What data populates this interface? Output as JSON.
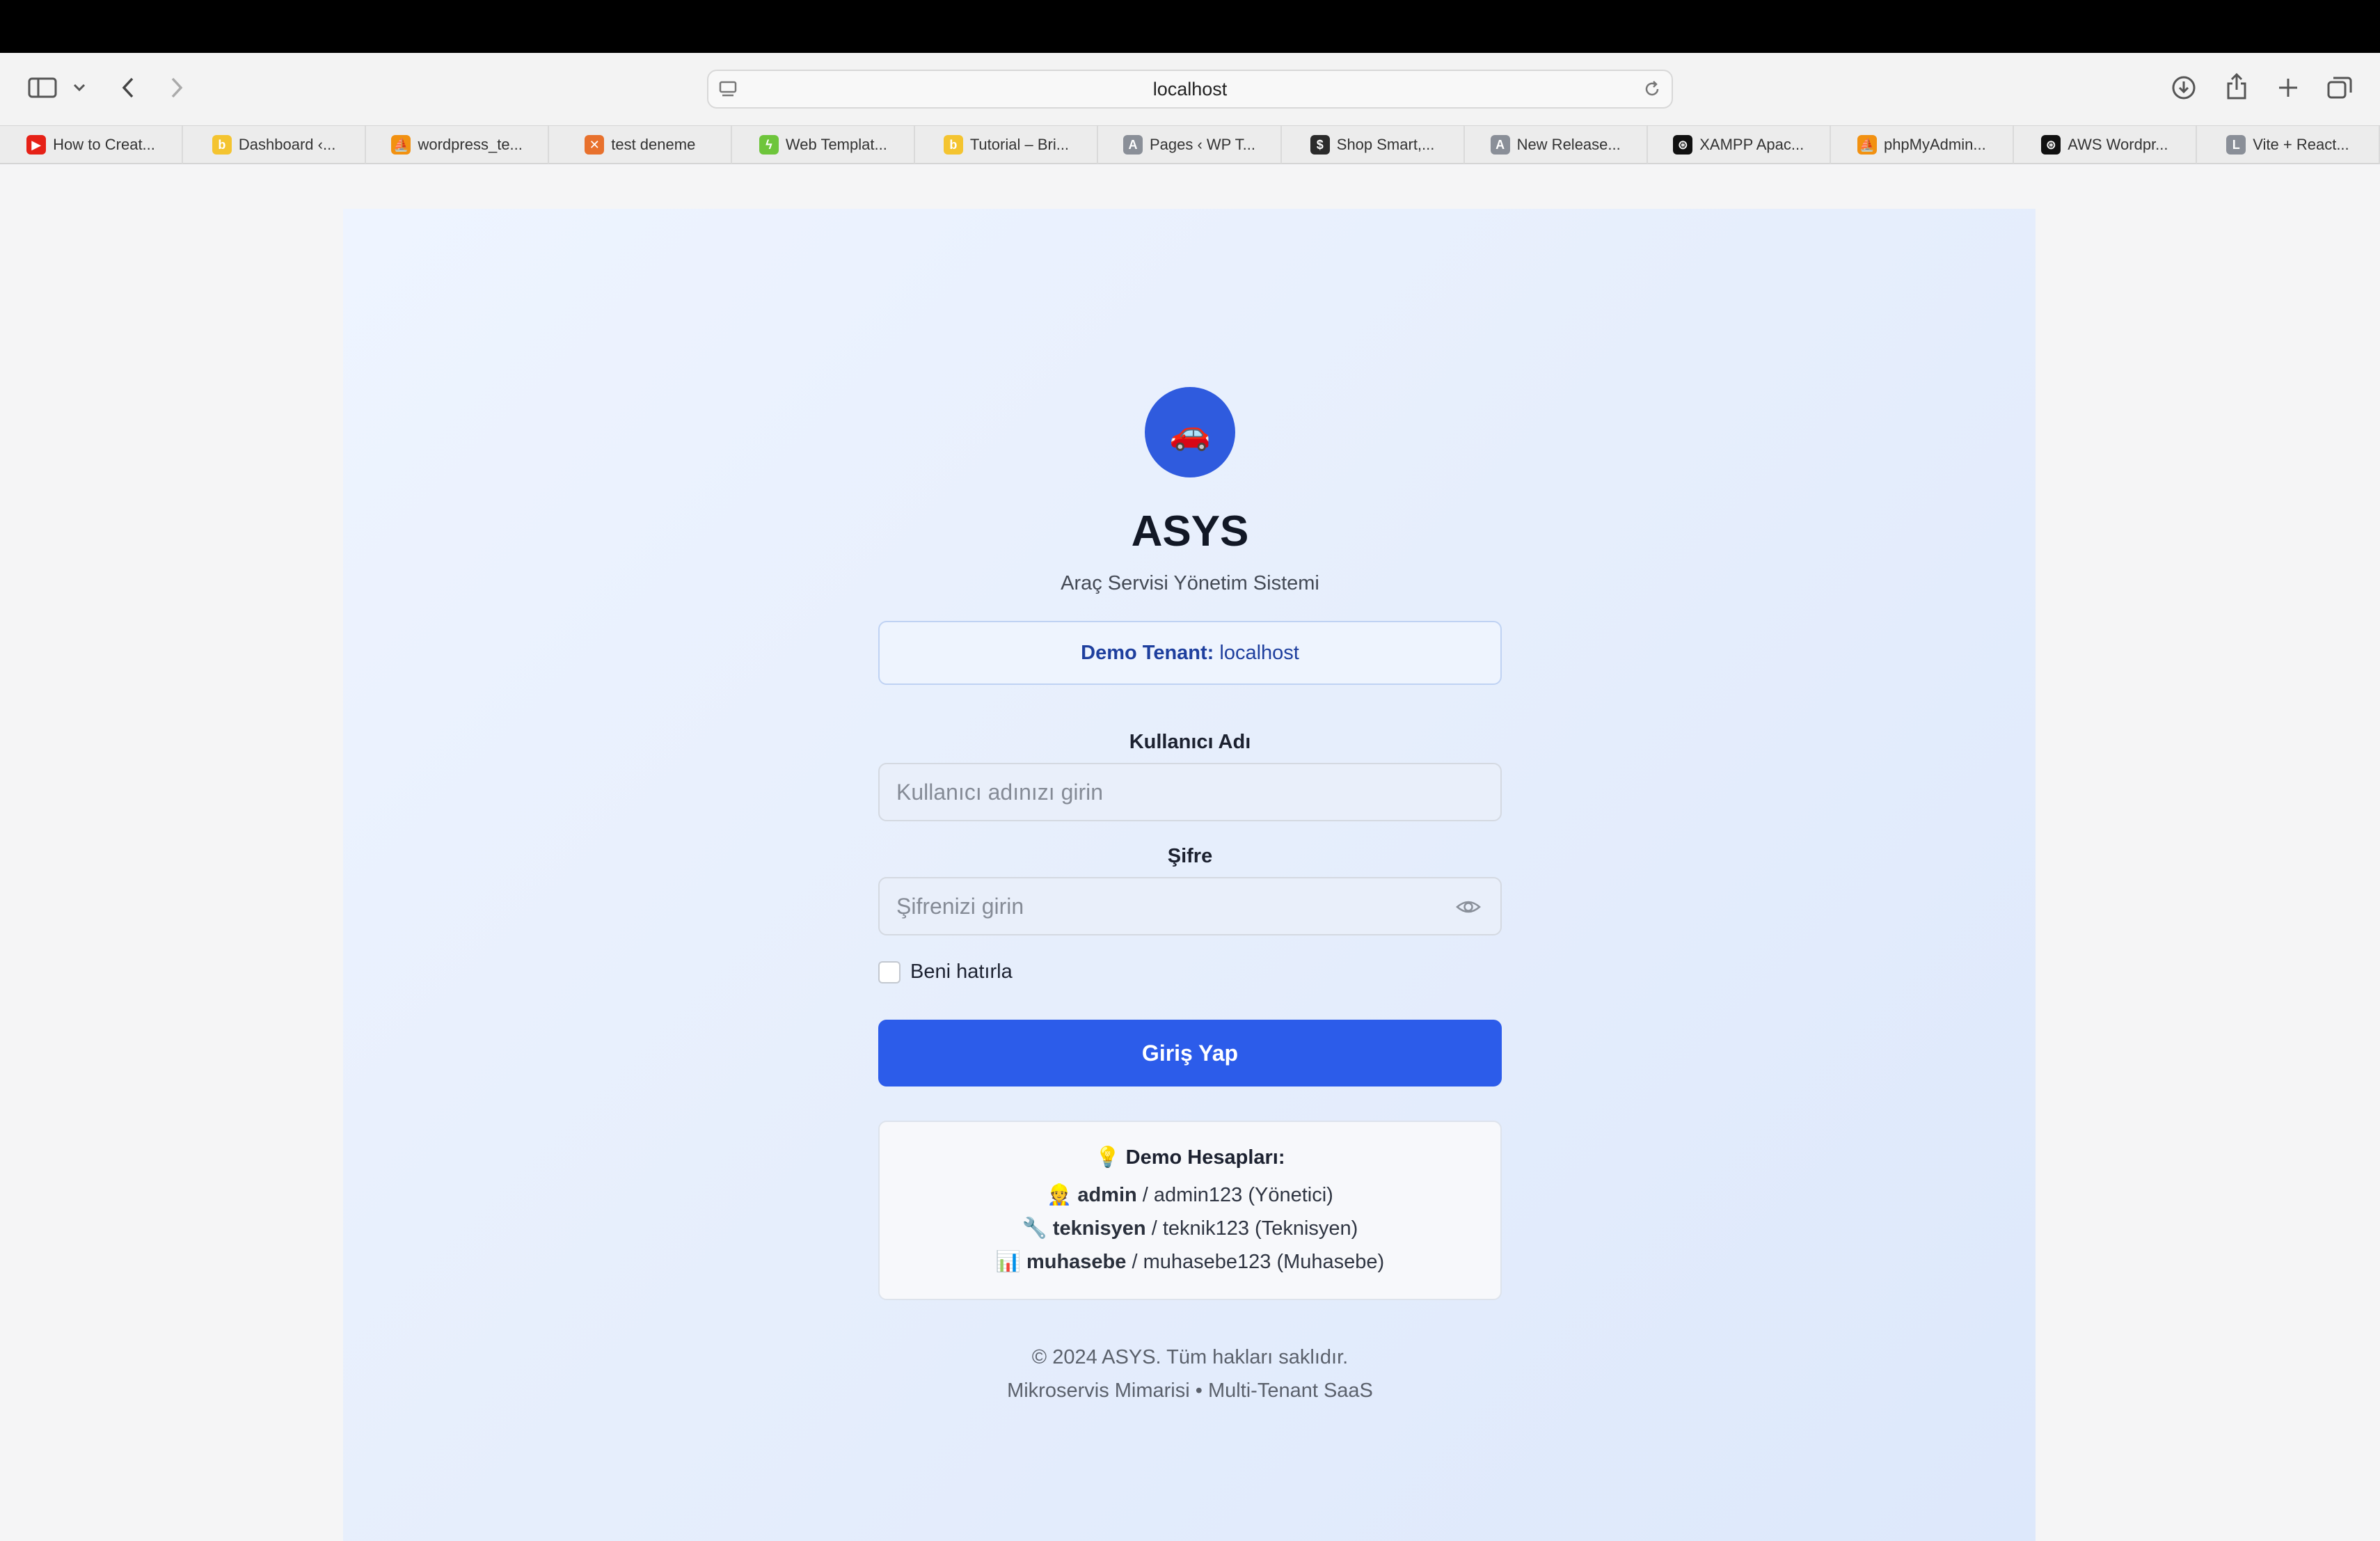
{
  "browser": {
    "url": "localhost",
    "bookmarks": [
      {
        "label": "How to Creat...",
        "icon": "youtube-icon",
        "color": "#e62117",
        "glyph": "▶"
      },
      {
        "label": "Dashboard ‹...",
        "icon": "b-icon",
        "color": "#f4c430",
        "glyph": "b"
      },
      {
        "label": "wordpress_te...",
        "icon": "phpmyadmin-icon",
        "color": "#f29111",
        "glyph": "⛵"
      },
      {
        "label": "test deneme",
        "icon": "xampp-icon",
        "color": "#e8712d",
        "glyph": "✕"
      },
      {
        "label": "Web Templat...",
        "icon": "envato-icon",
        "color": "#6ec53b",
        "glyph": "ϟ"
      },
      {
        "label": "Tutorial – Bri...",
        "icon": "b-icon",
        "color": "#f4c430",
        "glyph": "b"
      },
      {
        "label": "Pages ‹ WP T...",
        "icon": "a-icon",
        "color": "#8a8f98",
        "glyph": "A"
      },
      {
        "label": "Shop Smart,...",
        "icon": "shop-icon",
        "color": "#2b2b2b",
        "glyph": "$"
      },
      {
        "label": "New Release...",
        "icon": "a-icon",
        "color": "#8a8f98",
        "glyph": "A"
      },
      {
        "label": "XAMPP Apac...",
        "icon": "openai-icon",
        "color": "#111111",
        "glyph": "⊛"
      },
      {
        "label": "phpMyAdmin...",
        "icon": "phpmyadmin-icon",
        "color": "#f29111",
        "glyph": "⛵"
      },
      {
        "label": "AWS Wordpr...",
        "icon": "openai-icon",
        "color": "#111111",
        "glyph": "⊛"
      },
      {
        "label": "Vite + React...",
        "icon": "l-icon",
        "color": "#8a8f98",
        "glyph": "L"
      }
    ]
  },
  "app": {
    "logo_emoji": "🚗",
    "title": "ASYS",
    "subtitle": "Araç Servisi Yönetim Sistemi",
    "tenant": {
      "label": "Demo Tenant:",
      "value": "localhost"
    }
  },
  "form": {
    "username_label": "Kullanıcı Adı",
    "username_placeholder": "Kullanıcı adınızı girin",
    "password_label": "Şifre",
    "password_placeholder": "Şifrenizi girin",
    "remember_label": "Beni hatırla",
    "submit_label": "Giriş Yap"
  },
  "demo": {
    "title_icon": "💡",
    "title": "Demo Hesapları:",
    "accounts": [
      {
        "icon": "👷",
        "user": "admin",
        "rest": "/ admin123 (Yönetici)"
      },
      {
        "icon": "🔧",
        "user": "teknisyen",
        "rest": "/ teknik123 (Teknisyen)"
      },
      {
        "icon": "📊",
        "user": "muhasebe",
        "rest": "/ muhasebe123 (Muhasebe)"
      }
    ]
  },
  "footer": {
    "line1": "© 2024 ASYS. Tüm hakları saklıdır.",
    "line2": "Mikroservis Mimarisi • Multi-Tenant SaaS"
  },
  "colors": {
    "primary": "#2c5cea",
    "logo_bg": "#2f5bde",
    "tenant_text": "#1e3f9e"
  }
}
